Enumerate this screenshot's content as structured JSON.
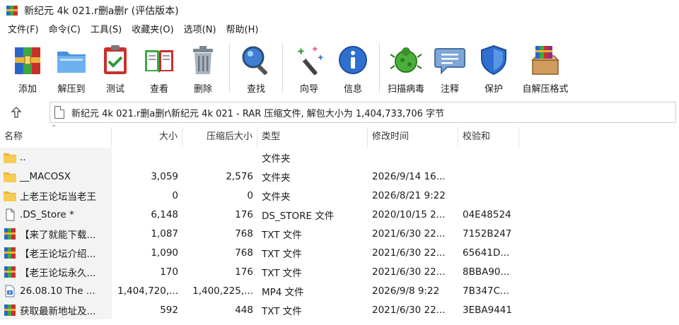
{
  "window": {
    "title": "新纪元 4k 021.r删a删r (评估版本)"
  },
  "menu": [
    {
      "label": "文件(F)"
    },
    {
      "label": "命令(C)"
    },
    {
      "label": "工具(S)"
    },
    {
      "label": "收藏夹(O)"
    },
    {
      "label": "选项(N)"
    },
    {
      "label": "帮助(H)"
    }
  ],
  "toolbar": {
    "add": "添加",
    "extract_to": "解压到",
    "test": "测试",
    "view": "查看",
    "delete": "删除",
    "find": "查找",
    "wizard": "向导",
    "info": "信息",
    "virus_scan": "扫描病毒",
    "comment": "注释",
    "protect": "保护",
    "sfx": "自解压格式"
  },
  "address": {
    "up_icon": "up-arrow-icon",
    "path": "新纪元 4k 021.r删a删r\\新纪元 4k 021 - RAR 压缩文件, 解包大小为 1,404,733,706 字节"
  },
  "columns": {
    "name": "名称",
    "size": "大小",
    "packed": "压缩后大小",
    "type": "类型",
    "modified": "修改时间",
    "crc": "校验和"
  },
  "files": [
    {
      "icon": "folder-up-icon",
      "name": "..",
      "size": "",
      "packed": "",
      "type": "文件夹",
      "modified": "",
      "crc": ""
    },
    {
      "icon": "folder-icon",
      "name": "__MACOSX",
      "size": "3,059",
      "packed": "2,576",
      "type": "文件夹",
      "modified": "2026/9/14 16...",
      "crc": ""
    },
    {
      "icon": "folder-icon",
      "name": "上老王论坛当老王",
      "size": "0",
      "packed": "0",
      "type": "文件夹",
      "modified": "2026/8/21 9:22",
      "crc": ""
    },
    {
      "icon": "file-icon",
      "name": ".DS_Store *",
      "size": "6,148",
      "packed": "176",
      "type": "DS_STORE 文件",
      "modified": "2020/10/15 2...",
      "crc": "04E48524"
    },
    {
      "icon": "rar-file-icon",
      "name": "【来了就能下载...",
      "size": "1,087",
      "packed": "768",
      "type": "TXT 文件",
      "modified": "2021/6/30 22...",
      "crc": "7152B247"
    },
    {
      "icon": "rar-file-icon",
      "name": "【老王论坛介绍...",
      "size": "1,090",
      "packed": "768",
      "type": "TXT 文件",
      "modified": "2021/6/30 22...",
      "crc": "65641D..."
    },
    {
      "icon": "rar-file-icon",
      "name": "【老王论坛永久...",
      "size": "170",
      "packed": "176",
      "type": "TXT 文件",
      "modified": "2021/6/30 22...",
      "crc": "8BBA90..."
    },
    {
      "icon": "video-file-icon",
      "name": "26.08.10 The ...",
      "size": "1,404,720,...",
      "packed": "1,400,225,...",
      "type": "MP4 文件",
      "modified": "2026/9/8 9:22",
      "crc": "7B347C..."
    },
    {
      "icon": "rar-file-icon",
      "name": "获取最新地址及...",
      "size": "592",
      "packed": "448",
      "type": "TXT 文件",
      "modified": "2021/6/30 22...",
      "crc": "3EBA9441"
    }
  ]
}
